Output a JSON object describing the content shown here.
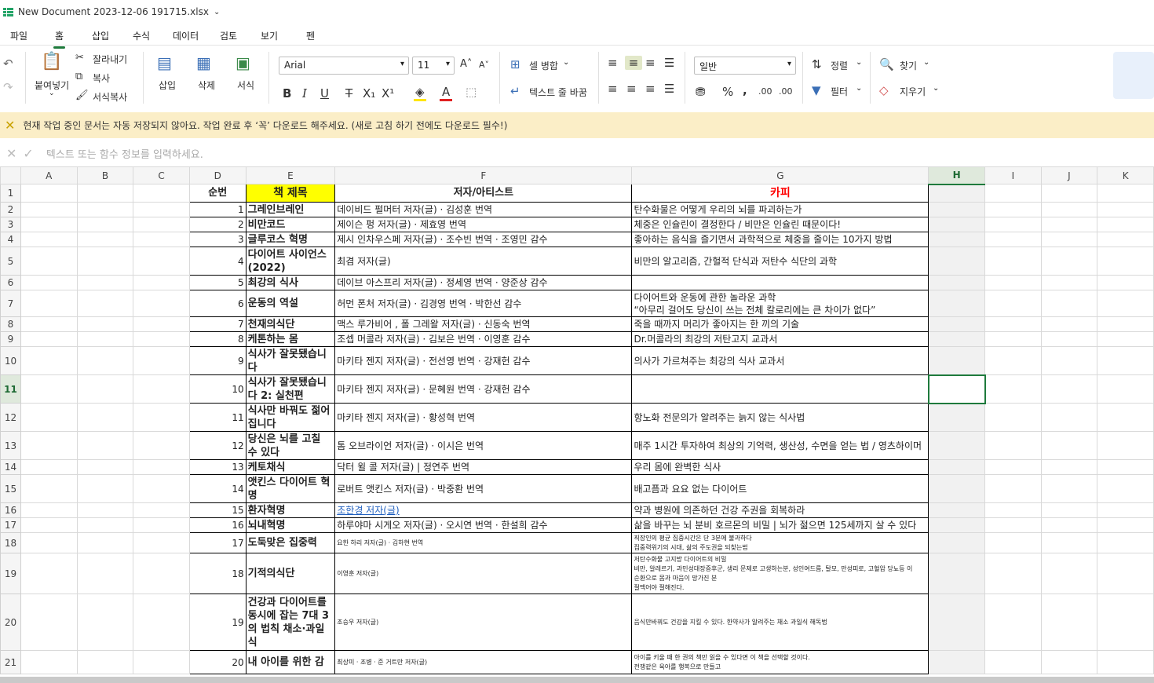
{
  "app": {
    "title": "New Document 2023-12-06 191715.xlsx",
    "accent": "#1e7a3c"
  },
  "menu": [
    "파일",
    "홈",
    "삽입",
    "수식",
    "데이터",
    "검토",
    "보기",
    "펜"
  ],
  "ribbon": {
    "paste": "붙여넣기",
    "cut": "잘라내기",
    "copy": "복사",
    "format_painter": "서식복사",
    "insert": "삽입",
    "delete": "삭제",
    "format": "서식",
    "font_name": "Arial",
    "font_size": "11",
    "merge": "셀 병합",
    "wrap": "텍스트 줄 바꿈",
    "number_format": "일반",
    "sort": "정렬",
    "filter": "필터",
    "find": "찾기",
    "clear": "지우기"
  },
  "notice": "현재 작업 중인 문서는 자동 저장되지 않아요. 작업 완료 후 ‘꼭’ 다운로드 해주세요. (새로 고침 하기 전에도 다운로드 필수!)",
  "formula_placeholder": "텍스트 또는 함수 정보를 입력하세요.",
  "columns": [
    "A",
    "B",
    "C",
    "D",
    "E",
    "F",
    "G",
    "H",
    "I",
    "J",
    "K"
  ],
  "header_row": {
    "num": "순번",
    "title": "책 제목",
    "author": "저자/아티스트",
    "copy": "카피"
  },
  "rows": [
    {
      "r": "2",
      "n": "1",
      "t": "그레인브레인",
      "a": "데이비드 펄머터 저자(글) · 김성훈 번역",
      "c": "탄수화물은 어떻게 우리의 뇌를 파괴하는가"
    },
    {
      "r": "3",
      "n": "2",
      "t": "비만코드",
      "a": "제이슨 펑 저자(글) · 제효영 번역",
      "c": "체중은 인슐린이 결정한다 / 비만은 인슐린 때문이다!"
    },
    {
      "r": "4",
      "n": "3",
      "t": "글루코스 혁명",
      "a": "제시 인차우스페 저자(글) · 조수빈 번역 · 조영민 감수",
      "c": "좋아하는 음식을 즐기면서 과학적으로 체중을 줄이는 10가지 방법"
    },
    {
      "r": "5",
      "n": "4",
      "t": "다이어트 사이언스(2022)",
      "a": "최겸 저자(글)",
      "c": "비만의 알고리즘, 간헐적 단식과 저탄수 식단의 과학"
    },
    {
      "r": "6",
      "n": "5",
      "t": "최강의 식사",
      "a": "데이브 아스프리 저자(글) · 정세영 번역 · 양준상 감수",
      "c": ""
    },
    {
      "r": "7",
      "n": "6",
      "t": "운동의 역설",
      "a": "허먼 폰처 저자(글) · 김경영 번역 · 박한선 감수",
      "c": "다이어트와 운동에 관한 놀라운 과학\n“아무리 걸어도 당신이 쓰는 전체 칼로리에는 큰 차이가 없다”"
    },
    {
      "r": "8",
      "n": "7",
      "t": "천재의식단",
      "a": "맥스 루가비어 , 폴 그레왈 저자(글) · 신동숙 번역",
      "c": "죽을 때까지 머리가 좋아지는 한 끼의 기술"
    },
    {
      "r": "9",
      "n": "8",
      "t": "케톤하는 몸",
      "a": "조셉 머콜라 저자(글) · 김보은 번역 · 이영훈 감수",
      "c": "Dr.머콜라의 최강의 저탄고지 교과서"
    },
    {
      "r": "10",
      "n": "9",
      "t": "식사가 잘못됐습니다",
      "a": "마키타 젠지 저자(글) · 전선영 번역 · 강재헌 감수",
      "c": "의사가 가르쳐주는 최강의 식사 교과서"
    },
    {
      "r": "11",
      "n": "10",
      "t": "식사가 잘못됐습니다 2: 실천편",
      "a": "마키타 젠지 저자(글) · 문혜원 번역 · 강재헌 감수",
      "c": ""
    },
    {
      "r": "12",
      "n": "11",
      "t": "식사만 바꿔도 젊어집니다",
      "a": "마키타 젠지 저자(글) · 황성혁 번역",
      "c": "항노화 전문의가 알려주는 늙지 않는 식사법"
    },
    {
      "r": "13",
      "n": "12",
      "t": "당신은 뇌를 고칠 수 있다",
      "a": "톰 오브라이언 저자(글) · 이시은 번역",
      "c": "매주 1시간 투자하여 최상의 기억력, 생산성, 수면을 얻는 법 / 영츠하이머"
    },
    {
      "r": "14",
      "n": "13",
      "t": "케토채식",
      "a": "닥터 윌 콜 저자(글) | 정연주 번역",
      "c": "우리 몸에 완벽한 식사"
    },
    {
      "r": "15",
      "n": "14",
      "t": "앳킨스 다이어트 혁명",
      "a": "로버트 앳킨스 저자(글) · 박중환 번역",
      "c": "배고픔과 요요 없는 다이어트"
    },
    {
      "r": "16",
      "n": "15",
      "t": "환자혁명",
      "a": "조한경 저자(글)",
      "c": "약과 병원에 의존하던 건강 주권을 회복하라"
    },
    {
      "r": "17",
      "n": "16",
      "t": "뇌내혁명",
      "a": "하루야마 시게오 저자(글) · 오시연 번역 · 한설희 감수",
      "c": "삶을 바꾸는 뇌 분비 호르몬의 비밀 | 뇌가 젊으면 125세까지 살 수 있다"
    },
    {
      "r": "18",
      "n": "17",
      "t": "도둑맞은 집중력",
      "a": "요한 하리 저자(글) · 김하현 번역",
      "c": "직장인의 평균 집중시간은 단 3분에 불과하다\n집중력위기의 시대, 삶의 주도권을 되찾는법"
    },
    {
      "r": "19",
      "n": "18",
      "t": "기적의식단",
      "a": "이영훈 저자(글)",
      "c": "저탄수화물 고지방 다이어트의 비밀\n비만, 알레르기, 과민성대장증후군, 생리 문제로 고생하는분, 성인여드름, 탈모, 만성피로, 고혈압 당뇨등 이\n순환으로 몸과 마음이 망가진 분\n절맥어야 절해진다."
    },
    {
      "r": "20",
      "n": "19",
      "t": "건강과 다이어트를 동시에 잡는 7대 3의 법칙 채소·과일식",
      "a": "조승우 저자(글)",
      "c": "음식만바꿔도 건강을 지킬 수 있다. 한약사가 알려주는 채소 과일식 해독법"
    },
    {
      "r": "21",
      "n": "20",
      "t": "내 아이를 위한 감",
      "a": "최상미 · 조병 · 준 거트만 저자(글)",
      "c": "아이를 키울 때 한 권의 책만 읽을 수 있다면 이 책을 선택할 것이다.\n전쟁같은 육아를 행복으로 만들고"
    }
  ]
}
